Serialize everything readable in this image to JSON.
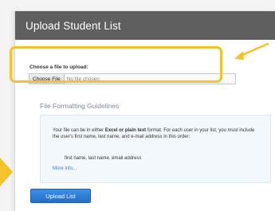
{
  "header": {
    "title": "Upload Student List"
  },
  "upload": {
    "label": "Choose a file to upload:",
    "choose_button": "Choose File",
    "file_status": "No file chosen"
  },
  "guidelines": {
    "title": "File Formatting Guidelines",
    "text_part1": "Your file can be in either ",
    "format_emphasis": "Excel or plain text",
    "text_part2": " format. For each user in your list, you must include the user's first name, last name, and e-mail address in this order:",
    "fields_line": "first name, last name, email address",
    "more_info": "More info..."
  },
  "actions": {
    "upload_button": "Upload List"
  },
  "colors": {
    "header_bg": "#5f5f5f",
    "highlight": "#f3c32b",
    "primary_button": "#2f7fd9",
    "link": "#3a7bd5"
  },
  "annotations": {
    "arrow_icon": "arrow-left-icon",
    "left_marker_icon": "triangle-right-icon"
  }
}
